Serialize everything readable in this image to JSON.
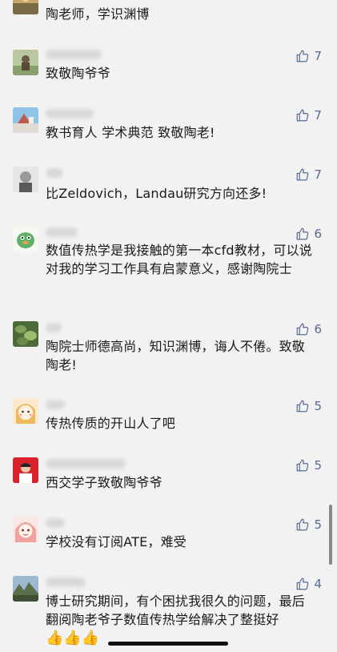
{
  "comments": [
    {
      "text": "陶老师，学识渊博",
      "likes": ""
    },
    {
      "text": "致敬陶爷爷",
      "likes": "7"
    },
    {
      "text": "教书育人 学术典范 致敬陶老!",
      "likes": "7"
    },
    {
      "text": "比Zeldovich，Landau研究方向还多!",
      "likes": "7"
    },
    {
      "text": "数值传热学是我接触的第一本cfd教材，可以说对我的学习工作具有启蒙意义，感谢陶院士",
      "likes": "6"
    },
    {
      "text": "陶院士师德高尚，知识渊博，诲人不倦。致敬陶老!",
      "likes": "6"
    },
    {
      "text": "传热传质的开山人了吧",
      "likes": "5"
    },
    {
      "text": "西交学子致敬陶爷爷",
      "likes": "5"
    },
    {
      "text": "学校没有订阅ATE，难受",
      "likes": "5"
    },
    {
      "text": "博士研究期间，有个困扰我很久的问题，最后翻阅陶老爷子数值传热学给解决了整挺好",
      "likes": "4"
    }
  ],
  "emoji_row": "👍👍👍",
  "colors": {
    "background": "#f2f2f2",
    "link": "#576b95",
    "text": "#1a1a1a"
  },
  "icons": {
    "like": "thumbs-up-outline-icon"
  }
}
